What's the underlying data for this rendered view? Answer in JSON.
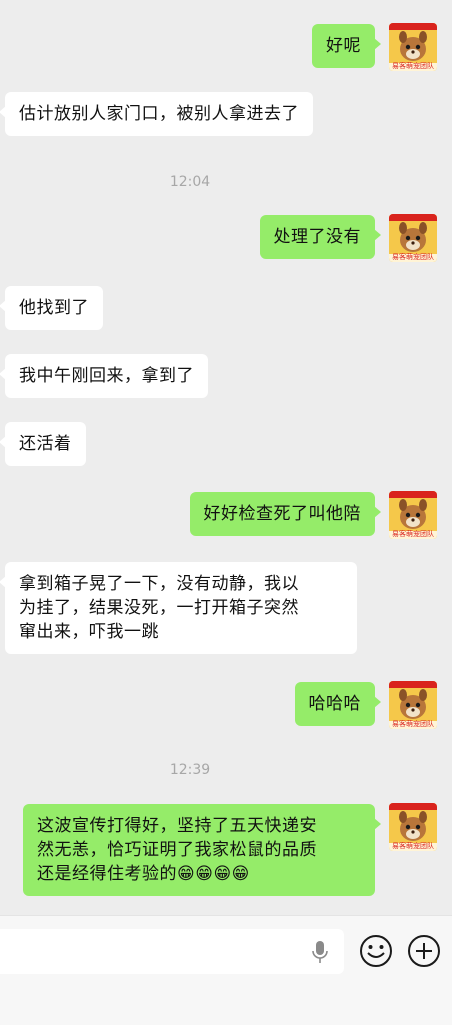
{
  "messages": [
    {
      "side": "right",
      "text": "好呢"
    },
    {
      "side": "left",
      "text": "估计放别人家门口，被别人拿进去了"
    },
    {
      "type": "time",
      "text": "12:04"
    },
    {
      "side": "right",
      "text": "处理了没有"
    },
    {
      "side": "left",
      "text": "他找到了"
    },
    {
      "side": "left",
      "text": "我中午刚回来，拿到了"
    },
    {
      "side": "left",
      "text": "还活着"
    },
    {
      "side": "right",
      "text": "好好检查死了叫他陪"
    },
    {
      "side": "left",
      "lines": [
        "拿到箱子晃了一下，没有动静，我以",
        "为挂了，结果没死，一打开箱子突然",
        "窜出来，吓我一跳"
      ]
    },
    {
      "side": "right",
      "text": "哈哈哈"
    },
    {
      "type": "time",
      "text": "12:39"
    },
    {
      "side": "right",
      "lines": [
        "这波宣传打得好，坚持了五天快递安",
        "然无恙，恰巧证明了我家松鼠的品质",
        "还是经得住考验的😁😁😁😁"
      ]
    }
  ],
  "avatar": {
    "caption": "易客萌宠团队",
    "brand_color": "#d9231d",
    "bg_color": "#f5c84a"
  },
  "input_bar": {
    "icons": [
      "voice-icon",
      "emoji-icon",
      "plus-icon"
    ]
  },
  "colors": {
    "self_bubble": "#95ec69",
    "other_bubble": "#ffffff",
    "background": "#ededed"
  }
}
